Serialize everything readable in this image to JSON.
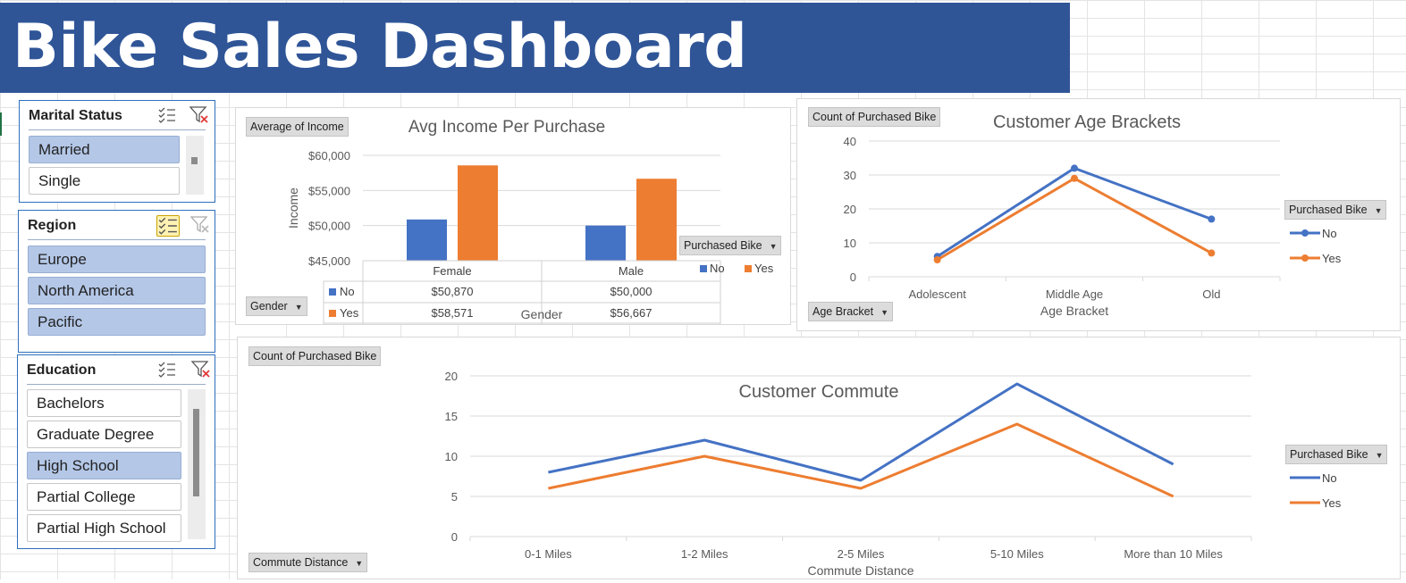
{
  "dashboard": {
    "title": "Bike Sales Dashboard"
  },
  "slicers": {
    "marital": {
      "title": "Marital Status",
      "items": [
        {
          "label": "Married",
          "selected": true
        },
        {
          "label": "Single",
          "selected": false
        }
      ]
    },
    "region": {
      "title": "Region",
      "items": [
        {
          "label": "Europe",
          "selected": true
        },
        {
          "label": "North America",
          "selected": true
        },
        {
          "label": "Pacific",
          "selected": true
        }
      ]
    },
    "education": {
      "title": "Education",
      "items": [
        {
          "label": "Bachelors",
          "selected": false
        },
        {
          "label": "Graduate Degree",
          "selected": false
        },
        {
          "label": "High School",
          "selected": true
        },
        {
          "label": "Partial College",
          "selected": false
        },
        {
          "label": "Partial High School",
          "selected": false
        }
      ]
    }
  },
  "colors": {
    "no": "#4472c4",
    "yes": "#ed7d31",
    "banner": "#2f5597",
    "slicer_selected": "#b4c7e7"
  },
  "chart_data": [
    {
      "type": "bar",
      "title": "Avg Income Per Purchase",
      "ylabel": "Income",
      "xlabel": "Gender",
      "categories": [
        "Female",
        "Male"
      ],
      "series": [
        {
          "name": "No",
          "values": [
            50870,
            50000
          ]
        },
        {
          "name": "Yes",
          "values": [
            58571,
            56667
          ]
        }
      ],
      "ylim": [
        45000,
        60000
      ],
      "yticks": [
        "$45,000",
        "$50,000",
        "$55,000",
        "$60,000"
      ],
      "table": [
        {
          "name": "No",
          "cells": [
            "$50,870",
            "$50,000"
          ]
        },
        {
          "name": "Yes",
          "cells": [
            "$58,571",
            "$56,667"
          ]
        }
      ],
      "field_buttons": {
        "value": "Average of Income",
        "axis": "Gender",
        "legend": "Purchased Bike"
      },
      "legend": "right"
    },
    {
      "type": "line",
      "title": "Customer Age Brackets",
      "xlabel": "Age Bracket",
      "categories": [
        "Adolescent",
        "Middle Age",
        "Old"
      ],
      "series": [
        {
          "name": "No",
          "values": [
            6,
            32,
            17
          ]
        },
        {
          "name": "Yes",
          "values": [
            5,
            29,
            7
          ]
        }
      ],
      "ylim": [
        0,
        40
      ],
      "yticks": [
        "0",
        "10",
        "20",
        "30",
        "40"
      ],
      "markers": true,
      "field_buttons": {
        "value": "Count of Purchased Bike",
        "axis": "Age Bracket",
        "legend": "Purchased Bike"
      },
      "legend": "right"
    },
    {
      "type": "line",
      "title": "Customer Commute",
      "xlabel": "Commute Distance",
      "categories": [
        "0-1 Miles",
        "1-2 Miles",
        "2-5 Miles",
        "5-10 Miles",
        "More than 10 Miles"
      ],
      "series": [
        {
          "name": "No",
          "values": [
            8,
            12,
            7,
            19,
            9
          ]
        },
        {
          "name": "Yes",
          "values": [
            6,
            10,
            6,
            14,
            5
          ]
        }
      ],
      "ylim": [
        0,
        20
      ],
      "yticks": [
        "0",
        "5",
        "10",
        "15",
        "20"
      ],
      "markers": false,
      "field_buttons": {
        "value": "Count of Purchased Bike",
        "axis": "Commute Distance",
        "legend": "Purchased Bike"
      },
      "legend": "right"
    }
  ]
}
